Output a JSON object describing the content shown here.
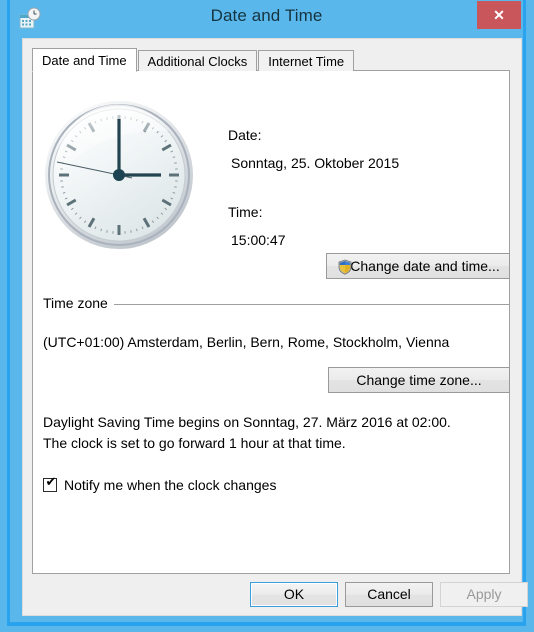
{
  "window": {
    "title": "Date and Time",
    "icon": "calendar-clock-icon",
    "close_label": "✕",
    "titlebar_color": "#5ab7ec",
    "close_button_color": "#c9565a"
  },
  "tabs": [
    {
      "label": "Date and Time",
      "active": true
    },
    {
      "label": "Additional Clocks",
      "active": false
    },
    {
      "label": "Internet Time",
      "active": false
    }
  ],
  "datetime": {
    "date_label": "Date:",
    "date_value": "Sonntag, 25. Oktober 2015",
    "time_label": "Time:",
    "time_value": "15:00:47",
    "change_button_label": "Change date and time...",
    "change_button_icon": "uac-shield-icon"
  },
  "clock": {
    "icon": "analog-clock-icon",
    "hour": 3,
    "minute": 0,
    "second": 47
  },
  "timezone": {
    "group_label": "Time zone",
    "value": "(UTC+01:00) Amsterdam, Berlin, Bern, Rome, Stockholm, Vienna",
    "change_button_label": "Change time zone..."
  },
  "dst": {
    "line1": "Daylight Saving Time begins on Sonntag, 27. März 2016 at 02:00.",
    "line2": "The clock is set to go forward 1 hour at that time.",
    "notify_label": "Notify me when the clock changes",
    "notify_checked": true,
    "checkmark": "✔"
  },
  "footer": {
    "ok_label": "OK",
    "cancel_label": "Cancel",
    "apply_label": "Apply",
    "apply_enabled": false
  }
}
